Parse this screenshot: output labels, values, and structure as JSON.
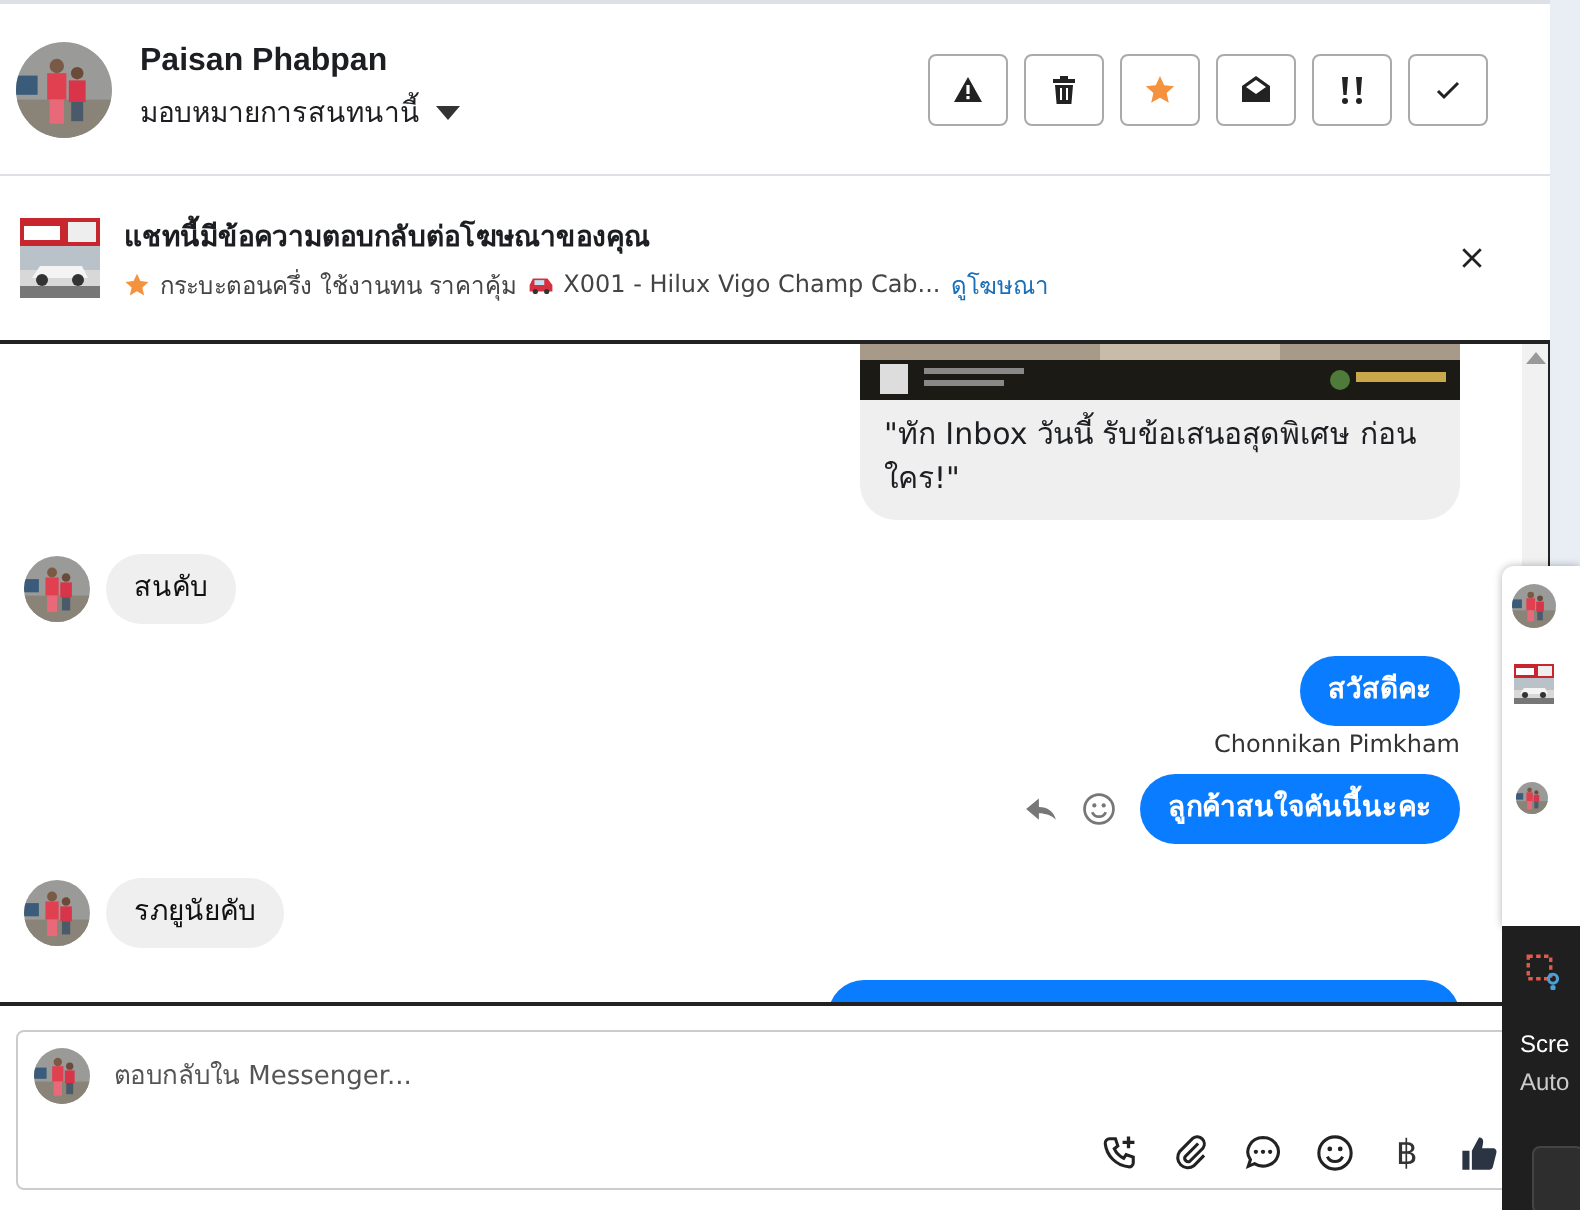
{
  "contact": {
    "name": "Paisan Phabpan",
    "assign_label": "มอบหมายการสนทนานี้"
  },
  "actions": [
    {
      "kind": "warning"
    },
    {
      "kind": "trash"
    },
    {
      "kind": "star"
    },
    {
      "kind": "envelope"
    },
    {
      "kind": "urgent"
    },
    {
      "kind": "check"
    }
  ],
  "ad_notice": {
    "title": "แชทนี้มีข้อความตอบกลับต่อโฆษณาของคุณ",
    "headline": "กระบะตอนครึ่ง ใช้งานทน ราคาคุ้ม",
    "product": "X001 - Hilux Vigo Champ Cab...",
    "link": "ดูโฆษณา"
  },
  "messages": [
    {
      "kind": "ad_card",
      "text": "\"ทัก Inbox วันนี้ รับข้อเสนอสุดพิเศษ ก่อนใคร!\""
    },
    {
      "kind": "incoming",
      "text": "สนคับ"
    },
    {
      "kind": "outgoing",
      "text": "สวัสดีคะ"
    },
    {
      "kind": "sender",
      "text": "Chonnikan Pimkham"
    },
    {
      "kind": "outgoing",
      "text": "ลูกค้าสนใจคันนี้นะคะ",
      "show_actions": true
    },
    {
      "kind": "incoming",
      "text": "รภยูนัยคับ"
    },
    {
      "kind": "outgoing_cut"
    }
  ],
  "composer": {
    "placeholder": "ตอบกลับใน Messenger...",
    "tools": [
      {
        "kind": "call"
      },
      {
        "kind": "attach"
      },
      {
        "kind": "chat"
      },
      {
        "kind": "emoji"
      },
      {
        "kind": "text",
        "label": "฿"
      },
      {
        "kind": "like"
      }
    ]
  },
  "toast": {
    "lines": [
      "Scre",
      "Auto"
    ]
  }
}
